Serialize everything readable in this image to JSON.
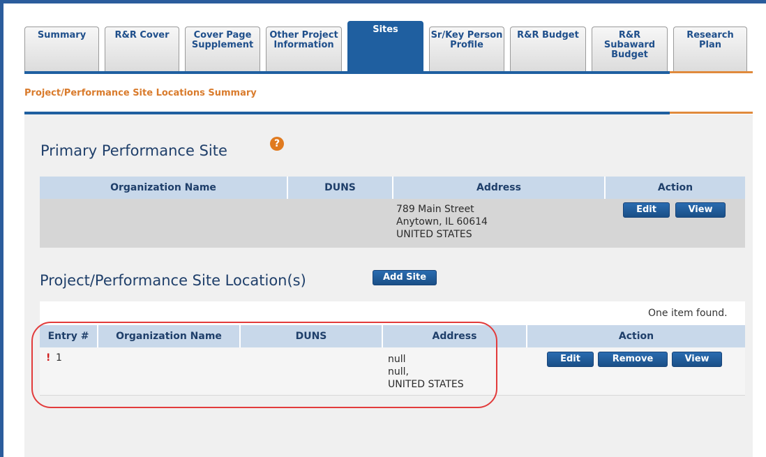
{
  "tabs": [
    {
      "label": "Summary"
    },
    {
      "label": "R&R Cover"
    },
    {
      "label": "Cover Page Supplement"
    },
    {
      "label": "Other Project Information"
    },
    {
      "label": "Sites"
    },
    {
      "label": "Sr/Key Person Profile"
    },
    {
      "label": "R&R Budget"
    },
    {
      "label": "R&R Subaward Budget"
    },
    {
      "label": "Research Plan"
    }
  ],
  "active_tab": "Sites",
  "subheader": "Project/Performance Site Locations Summary",
  "primary": {
    "title": "Primary Performance Site",
    "help_glyph": "?",
    "columns": [
      "Organization Name",
      "DUNS",
      "Address",
      "Action"
    ],
    "row": {
      "org": "",
      "duns": "",
      "address_line1": "789 Main Street",
      "address_line2": "Anytown, IL 60614",
      "address_line3": "UNITED STATES",
      "edit": "Edit",
      "view": "View"
    }
  },
  "locations": {
    "title": "Project/Performance Site Location(s)",
    "add_button": "Add Site",
    "count_text": "One item found.",
    "columns": [
      "Entry #",
      "Organization Name",
      "DUNS",
      "Address",
      "Action"
    ],
    "row": {
      "warning": "!",
      "entry": "1",
      "org": "",
      "duns": "",
      "address_line1": "null",
      "address_line2": "null,",
      "address_line3": "UNITED STATES",
      "edit": "Edit",
      "remove": "Remove",
      "view": "View"
    }
  },
  "colors": {
    "brand_blue": "#1f5fa0",
    "accent_orange": "#e08a3c",
    "highlight_red": "#e23b3b"
  }
}
